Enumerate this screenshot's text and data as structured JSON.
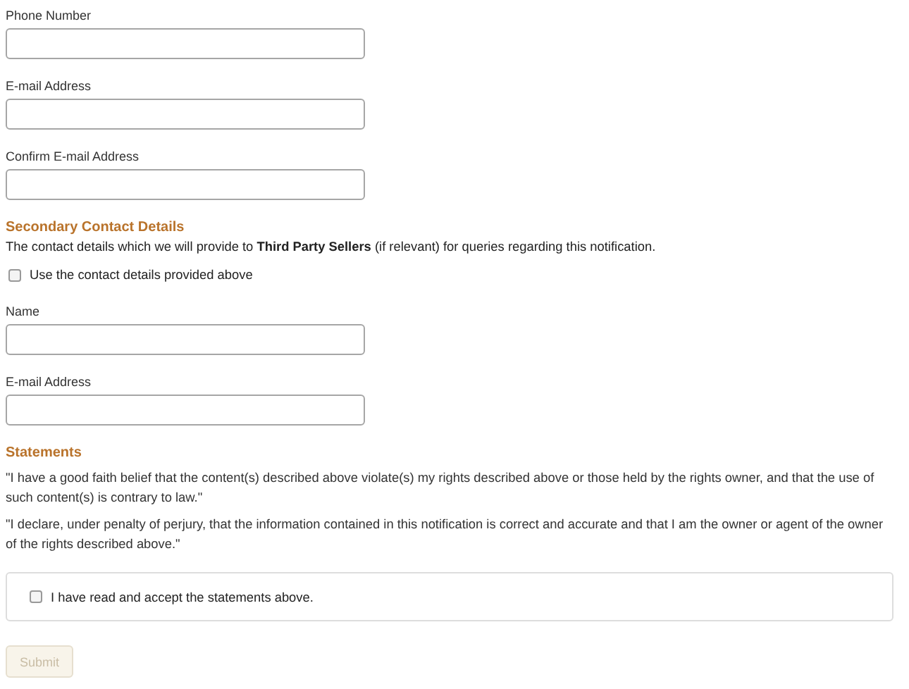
{
  "contact_fields": [
    {
      "label": "Phone Number"
    },
    {
      "label": "E-mail Address"
    },
    {
      "label": "Confirm E-mail Address"
    }
  ],
  "secondary_contact": {
    "heading": "Secondary Contact Details",
    "description": "The contact details which we will provide to **Third Party Sellers** (if relevant) for queries regarding this notification.",
    "use_above": {
      "label": "Use the contact details provided above",
      "checked": false
    },
    "fields": [
      {
        "label": "Name"
      },
      {
        "label": "E-mail Address"
      }
    ]
  },
  "statements": {
    "heading": "Statements",
    "paragraphs": [
      "\"I have a good faith belief that the content(s) described above violate(s) my rights described above or those held by the rights owner, and that the use of such content(s) is contrary to law.\"",
      "\"I declare, under penalty of perjury, that the information contained in this notification is correct and accurate and that I am the owner or agent of the owner of the rights described above.\""
    ],
    "accept": {
      "label": "I have read and accept the statements above.",
      "checked": false
    }
  },
  "submit": {
    "label": "Submit",
    "disabled": true
  }
}
